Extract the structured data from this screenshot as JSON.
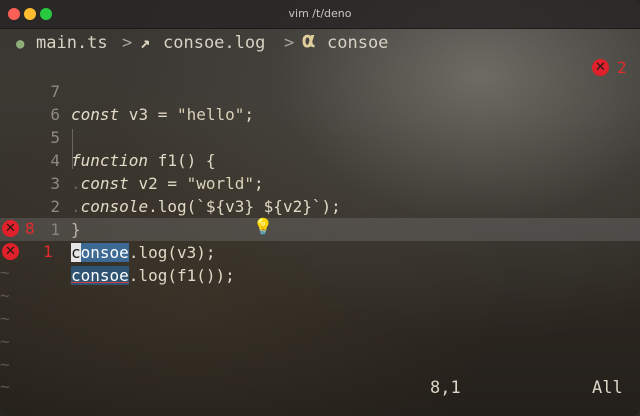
{
  "window": {
    "title": "vim /t/deno"
  },
  "breadcrumbs": {
    "file": "main.ts",
    "sep1": ">",
    "fn_icon": "↗",
    "fn": "consoe.log",
    "sep2": ">",
    "cls_icon": "α",
    "cls": "consoe"
  },
  "lines": [
    {
      "num": "7",
      "text": "const v3 = \"hello\";"
    },
    {
      "num": "6",
      "text": ""
    },
    {
      "num": "5",
      "text": "function f1() {"
    },
    {
      "num": "4",
      "text": "const v2 = \"world\";"
    },
    {
      "num": "3",
      "text": "console.log(`${v3} ${v2}`);"
    },
    {
      "num": "2",
      "text": "}"
    },
    {
      "num": "1",
      "text": ""
    },
    {
      "num": "8",
      "text": "consoe.log(v3);"
    },
    {
      "num": "1",
      "text": "consoe.log(f1());"
    }
  ],
  "diagnostics": {
    "line7_right_count": "2",
    "line8_count": "8",
    "line9_count": "1"
  },
  "status": {
    "position": "8,1",
    "scroll": "All"
  },
  "tildes": [
    "~",
    "~",
    "~",
    "~",
    "~",
    "~"
  ],
  "colors": {
    "error": "#e0202a",
    "highlight": "#3d6a94",
    "bulb": "#f1cc3d"
  }
}
